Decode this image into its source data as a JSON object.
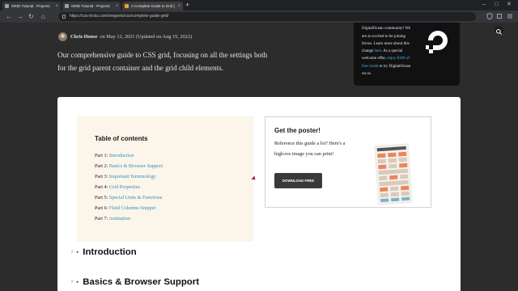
{
  "browser": {
    "tabs": [
      {
        "label": "GRID Tutorial - Project1",
        "active": false
      },
      {
        "label": "GRID Tutorial - Project2",
        "active": false
      },
      {
        "label": "A Complete Guide to Grid | CSS-Tricks",
        "active": true
      }
    ],
    "url": "https://css-tricks.com/snippets/css/complete-guide-grid/"
  },
  "author": {
    "name": "Chris House",
    "dates": "on May 12, 2021 (Updated on Aug 19, 2022)"
  },
  "intro": "Our comprehensive guide to CSS grid, focusing on all the settings both for the grid parent container and the grid child elements.",
  "ad": {
    "line1": "CSS-Tricks is joining the DigitalOcean community! We are so excited to be joining forces. Learn more about this change",
    "link1": "here",
    "line2": ". As a special welcome offer,",
    "link2": "enjoy $100 of free credit",
    "line3": "to try DigitalOcean on us."
  },
  "toc": {
    "title": "Table of contents",
    "items": [
      {
        "part": "Part 1:",
        "label": "Introduction"
      },
      {
        "part": "Part 2:",
        "label": "Basics & Browser Support"
      },
      {
        "part": "Part 3:",
        "label": "Important Terminology"
      },
      {
        "part": "Part 4:",
        "label": "Grid Properties"
      },
      {
        "part": "Part 5:",
        "label": "Special Units & Functions"
      },
      {
        "part": "Part 6:",
        "label": "Fluid Columns Snippet"
      },
      {
        "part": "Part 7:",
        "label": "Animation"
      }
    ]
  },
  "poster": {
    "title": "Get the poster!",
    "description": "Reference this guide a lot? Here's a high-res image you can print!",
    "button": "DOWNLOAD FREE"
  },
  "sections": [
    {
      "link": "#",
      "title": "Introduction"
    },
    {
      "link": "#",
      "title": "Basics & Browser Support"
    }
  ],
  "colors": {
    "page_bg": "#2c2c2c",
    "link": "#2e8fbd",
    "ad_link": "#47b7e8",
    "toc_bg": "#fbf5ea"
  }
}
